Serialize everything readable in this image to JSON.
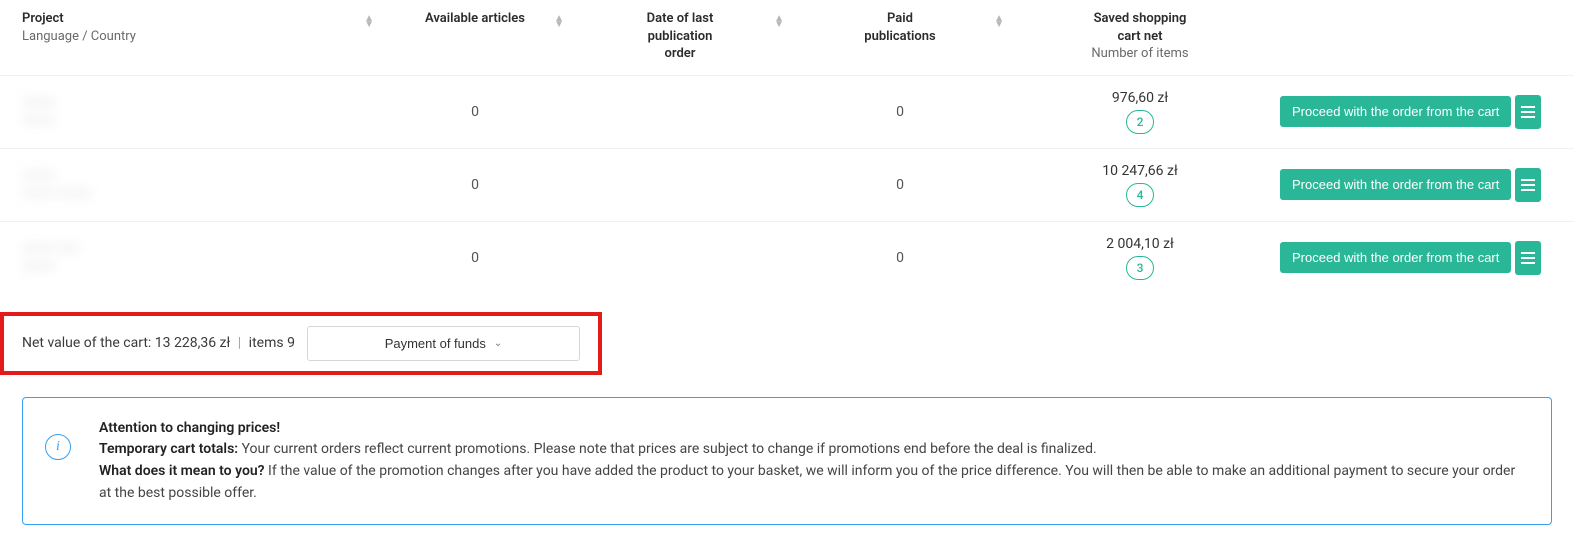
{
  "header": {
    "project_label": "Project",
    "project_sub": "Language / Country",
    "available_label": "Available articles",
    "date_line1": "Date of last",
    "date_line2": "publication",
    "date_line3": "order",
    "paid_line1": "Paid",
    "paid_line2": "publications",
    "saved_line1": "Saved shopping",
    "saved_line2": "cart net",
    "saved_sub": "Number of items"
  },
  "rows": [
    {
      "proj_title": "———",
      "proj_sub": "———",
      "available": "0",
      "date": "",
      "paid": "0",
      "price": "976,60 zł",
      "count": "2"
    },
    {
      "proj_title": "———",
      "proj_sub": "——— ———",
      "available": "0",
      "date": "",
      "paid": "0",
      "price": "10 247,66 zł",
      "count": "4"
    },
    {
      "proj_title": "——— ——",
      "proj_sub": "———",
      "available": "0",
      "date": "",
      "paid": "0",
      "price": "2 004,10 zł",
      "count": "3"
    }
  ],
  "button_proceed": "Proceed with the order from the cart",
  "summary": {
    "label": "Net value of the cart: ",
    "value": "13 228,36 zł",
    "items_label": "items ",
    "items": "9",
    "dropdown": "Payment of funds"
  },
  "info": {
    "l1b": "Attention to changing prices!",
    "l2b": "Temporary cart totals: ",
    "l2t": "Your current orders reflect current promotions. Please note that prices are subject to change if promotions end before the deal is finalized.",
    "l3b": "What does it mean to you? ",
    "l3t": "If the value of the promotion changes after you have added the product to your basket, we will inform you of the price difference. You will then be able to make an additional payment to secure your order at the best possible offer."
  }
}
